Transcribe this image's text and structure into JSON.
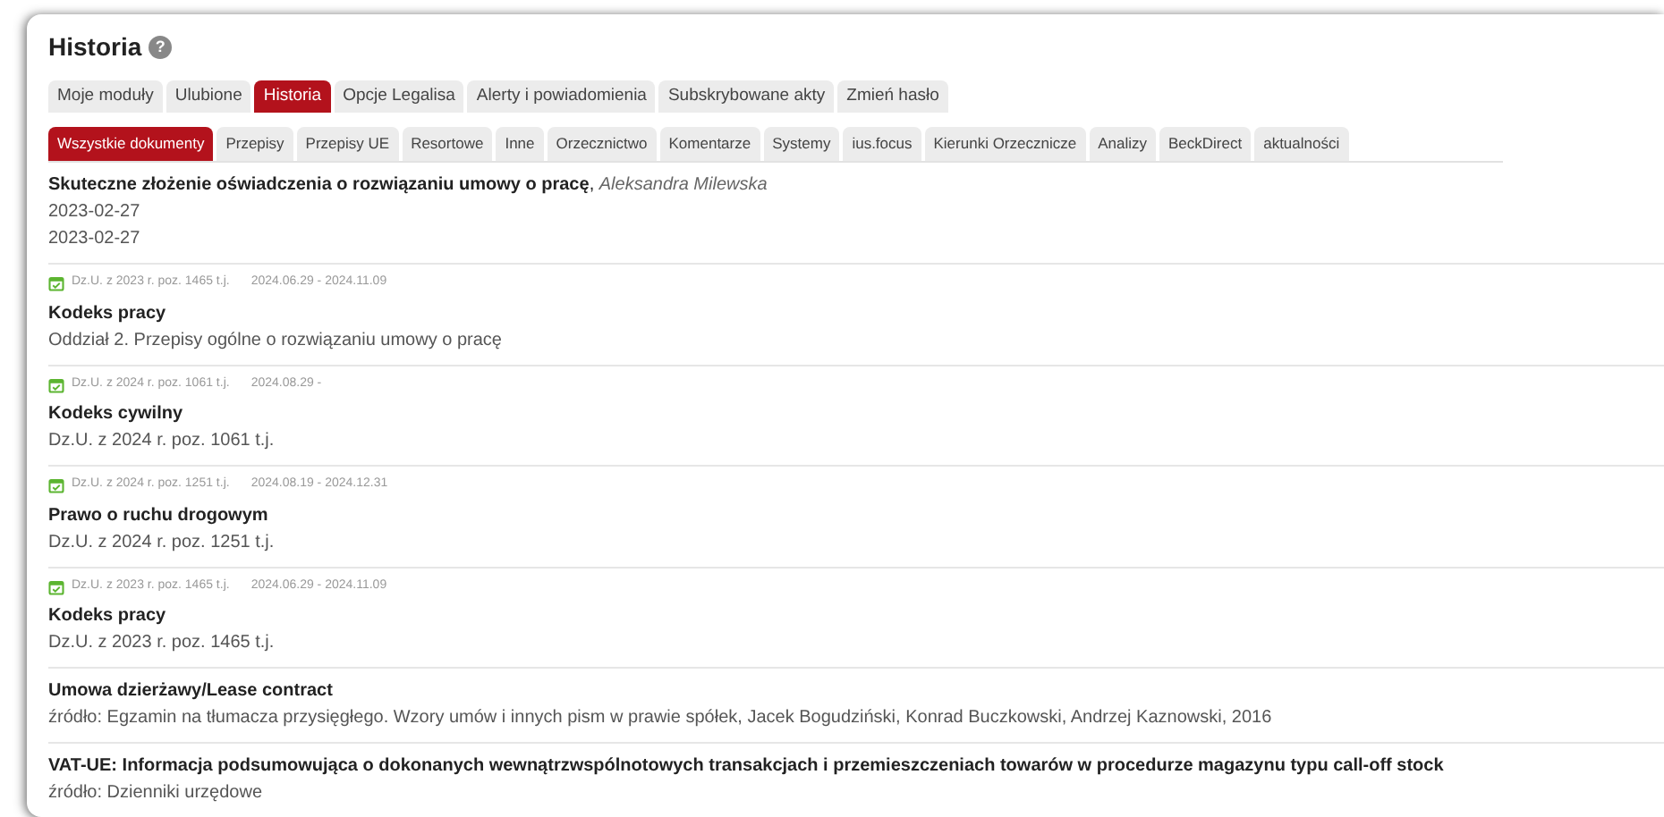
{
  "page_title": "Historia",
  "help_icon": "?",
  "main_tabs": [
    {
      "label": "Moje moduły",
      "selected": false
    },
    {
      "label": "Ulubione",
      "selected": false
    },
    {
      "label": "Historia",
      "selected": true
    },
    {
      "label": "Opcje Legalisa",
      "selected": false
    },
    {
      "label": "Alerty i powiadomienia",
      "selected": false
    },
    {
      "label": "Subskrybowane akty",
      "selected": false
    },
    {
      "label": "Zmień hasło",
      "selected": false
    }
  ],
  "sub_tabs": [
    {
      "label": "Wszystkie dokumenty",
      "selected": true
    },
    {
      "label": "Przepisy",
      "selected": false
    },
    {
      "label": "Przepisy UE",
      "selected": false
    },
    {
      "label": "Resortowe",
      "selected": false
    },
    {
      "label": "Inne",
      "selected": false
    },
    {
      "label": "Orzecznictwo",
      "selected": false
    },
    {
      "label": "Komentarze",
      "selected": false
    },
    {
      "label": "Systemy",
      "selected": false
    },
    {
      "label": "ius.focus",
      "selected": false
    },
    {
      "label": "Kierunki Orzecznicze",
      "selected": false
    },
    {
      "label": "Analizy",
      "selected": false
    },
    {
      "label": "BeckDirect",
      "selected": false
    },
    {
      "label": "aktualności",
      "selected": false
    }
  ],
  "items": [
    {
      "kind": "document",
      "heading": "**Skuteczne złożenie oświadczenia o rozwiązaniu umowy o pracę**, *Aleksandra Milewska*",
      "dates": [
        "2023-02-27",
        "2023-02-27"
      ]
    },
    {
      "kind": "act",
      "reference": "Dz.U. z 2023 r. poz. 1465 t.j.",
      "validity": "2024.06.29 - 2024.11.09",
      "title": "Kodeks pracy",
      "subtitle": "Oddział 2. Przepisy ogólne o rozwiązaniu umowy o pracę"
    },
    {
      "kind": "act",
      "reference": "Dz.U. z 2024 r. poz. 1061 t.j.",
      "validity": "2024.08.29 -",
      "title": "Kodeks cywilny",
      "subtitle": "Dz.U. z 2024 r. poz. 1061 t.j."
    },
    {
      "kind": "act",
      "reference": "Dz.U. z 2024 r. poz. 1251 t.j.",
      "validity": "2024.08.19 - 2024.12.31",
      "title": "Prawo o ruchu drogowym",
      "subtitle": "Dz.U. z 2024 r. poz. 1251 t.j."
    },
    {
      "kind": "act",
      "reference": "Dz.U. z 2023 r. poz. 1465 t.j.",
      "validity": "2024.06.29 - 2024.11.09",
      "title": "Kodeks pracy",
      "subtitle": "Dz.U. z 2023 r. poz. 1465 t.j."
    },
    {
      "kind": "source",
      "title": "Umowa dzierżawy/Lease contract",
      "source": "źródło: Egzamin na tłumacza przysięgłego. Wzory umów i innych pism w prawie spółek, Jacek Bogudziński, Konrad Buczkowski, Andrzej Kaznowski, 2016"
    },
    {
      "kind": "source",
      "title": "VAT-UE: Informacja podsumowująca o dokonanych wewnątrzwspólnotowych transakcjach i przemieszczeniach towarów w procedurze magazynu typu call-off stock",
      "source": "źródło: Dzienniki urzędowe"
    }
  ]
}
